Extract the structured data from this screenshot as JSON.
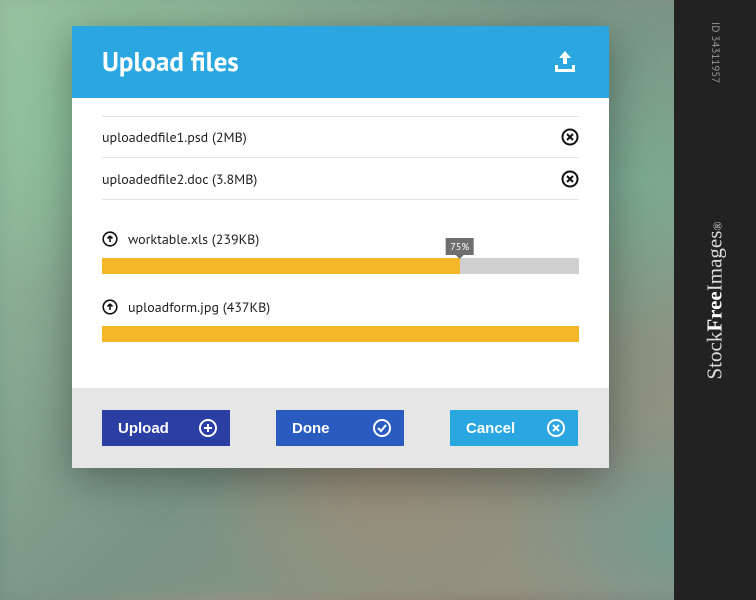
{
  "header": {
    "title": "Upload files"
  },
  "completed_files": [
    {
      "name": "uploadedfile1.psd",
      "size": "2MB"
    },
    {
      "name": "uploadedfile2.doc",
      "size": "3.8MB"
    }
  ],
  "uploading_files": [
    {
      "name": "worktable.xls",
      "size": "239KB",
      "progress_percent": 75,
      "progress_label": "75%"
    },
    {
      "name": "uploadform.jpg",
      "size": "437KB",
      "progress_percent": 100,
      "progress_label": ""
    }
  ],
  "buttons": {
    "upload": "Upload",
    "done": "Done",
    "cancel": "Cancel"
  },
  "watermark": {
    "id": "ID 34311957",
    "brand_prefix": "Stock",
    "brand_bold": "Free",
    "brand_suffix": "Images",
    "reg": "®",
    "diag": "StockFreeImages"
  },
  "colors": {
    "primary": "#2aa6e0",
    "progress": "#f4b728",
    "btn_upload": "#2b3ea3",
    "btn_done": "#2a5cc0",
    "btn_cancel": "#2aa6e0"
  }
}
